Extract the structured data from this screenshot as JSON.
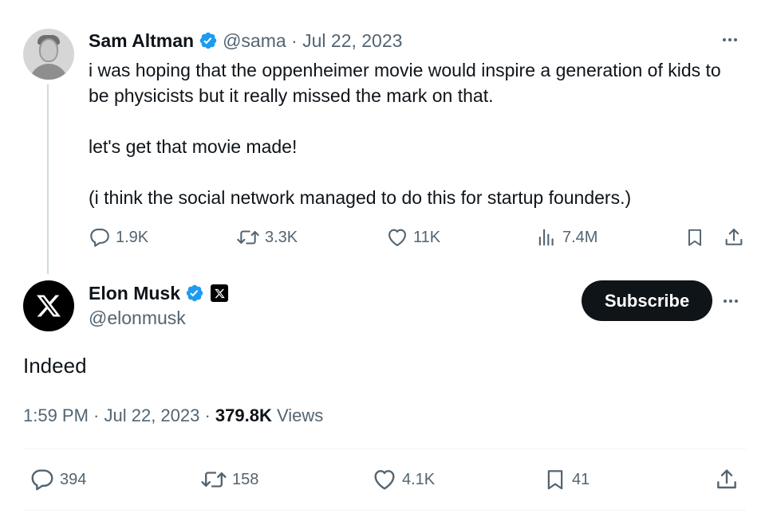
{
  "parent_tweet": {
    "author_name": "Sam Altman",
    "meta": "@sama · Jul 22, 2023",
    "paragraphs": [
      "i was hoping that the oppenheimer movie would inspire a generation of kids to be physicists but it really missed the mark on that.",
      "let's get that movie made!",
      "(i think the social network managed to do this for startup founders.)"
    ],
    "actions": {
      "replies": "1.9K",
      "reposts": "3.3K",
      "likes": "11K",
      "views": "7.4M"
    }
  },
  "main_tweet": {
    "author_name": "Elon Musk",
    "handle": "@elonmusk",
    "subscribe_label": "Subscribe",
    "text": "Indeed",
    "time_date": "1:59 PM · Jul 22, 2023 · ",
    "views_count": "379.8K",
    "views_label": " Views",
    "actions": {
      "replies": "394",
      "reposts": "158",
      "likes": "4.1K",
      "bookmarks": "41"
    }
  },
  "colors": {
    "verified_blue": "#1d9bf0",
    "text_primary": "#0f1419",
    "text_secondary": "#536471",
    "button_dark": "#0f1419"
  },
  "icons": [
    "verified-badge-icon",
    "more-icon",
    "reply-icon",
    "repost-icon",
    "like-icon",
    "views-icon",
    "bookmark-icon",
    "share-icon",
    "x-logo-icon"
  ]
}
